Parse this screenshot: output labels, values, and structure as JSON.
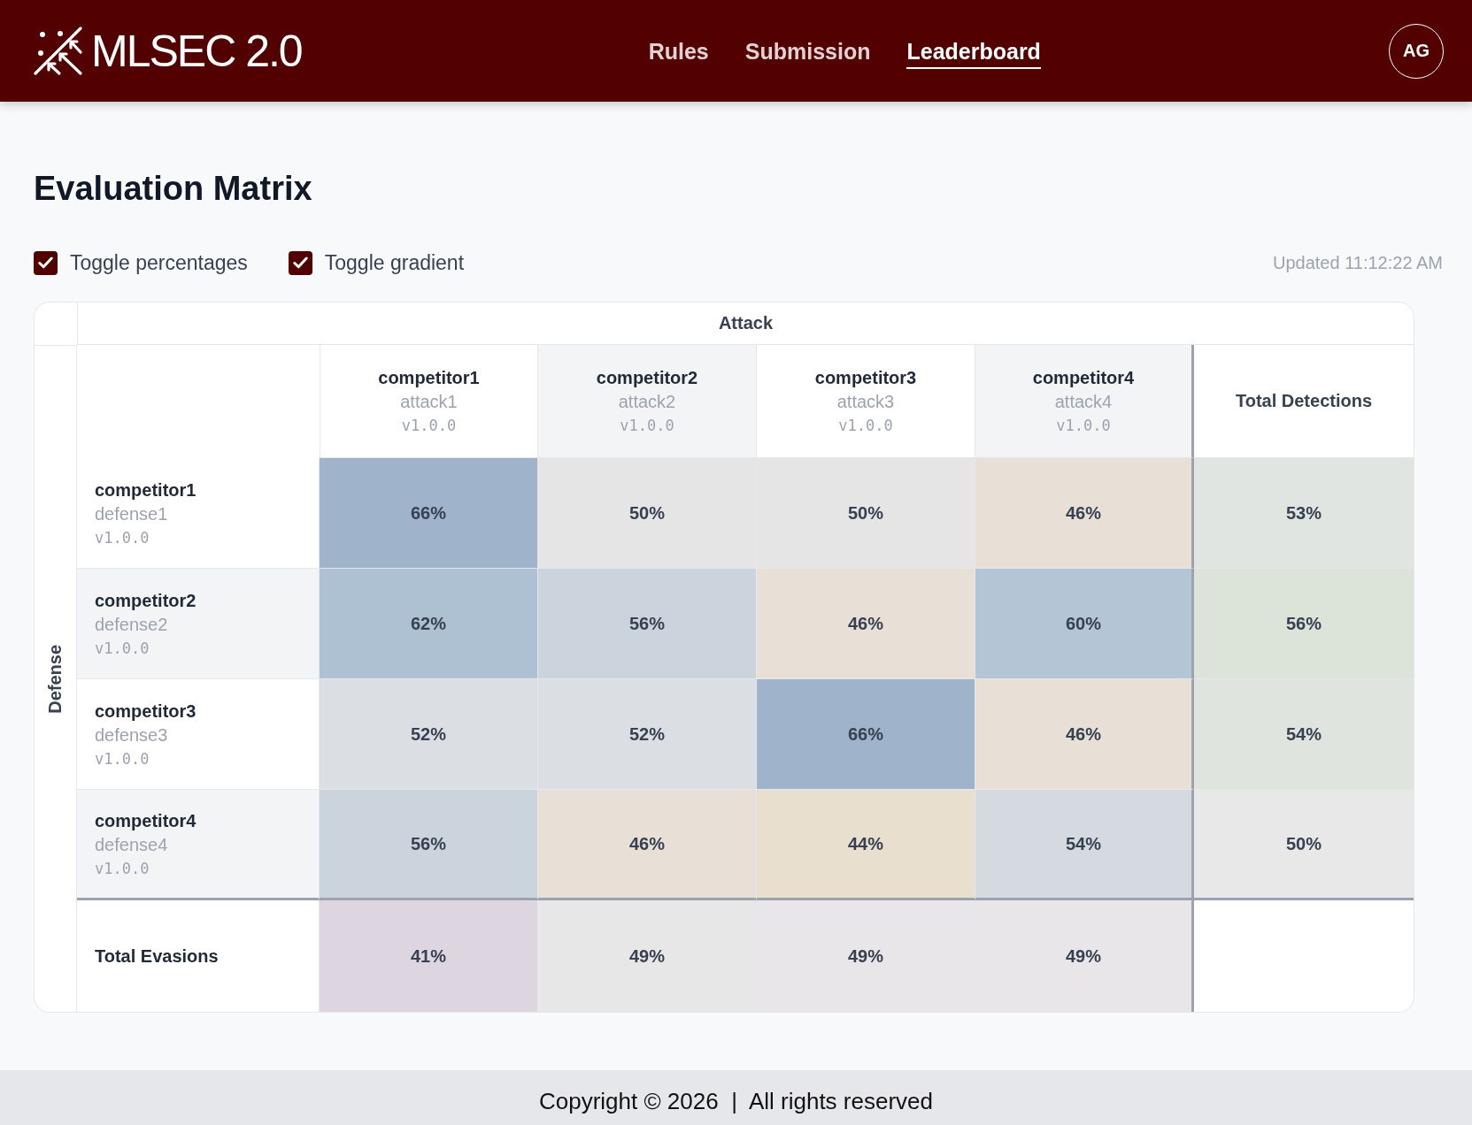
{
  "header": {
    "logo": "MLSEC 2.0",
    "nav": [
      {
        "label": "Rules",
        "selected": false
      },
      {
        "label": "Submission",
        "selected": false
      },
      {
        "label": "Leaderboard",
        "selected": true
      }
    ],
    "avatar": "AG"
  },
  "page": {
    "title": "Evaluation Matrix",
    "toggles": [
      {
        "label": "Toggle percentages",
        "checked": true
      },
      {
        "label": "Toggle gradient",
        "checked": true
      }
    ],
    "updated": "Updated 11:12:22 AM"
  },
  "matrix": {
    "attack_label": "Attack",
    "defense_label": "Defense",
    "columns": [
      {
        "name": "competitor1",
        "submission": "attack1",
        "version": "v1.0.0"
      },
      {
        "name": "competitor2",
        "submission": "attack2",
        "version": "v1.0.0"
      },
      {
        "name": "competitor3",
        "submission": "attack3",
        "version": "v1.0.0"
      },
      {
        "name": "competitor4",
        "submission": "attack4",
        "version": "v1.0.0"
      }
    ],
    "total_column": "Total Detections",
    "rows": [
      {
        "name": "competitor1",
        "submission": "defense1",
        "version": "v1.0.0",
        "cells": [
          {
            "value": "66%",
            "color": "#9fb4cb"
          },
          {
            "value": "50%",
            "color": "#e5e5e5"
          },
          {
            "value": "50%",
            "color": "#e5e5e5"
          },
          {
            "value": "46%",
            "color": "#e8e0d7"
          }
        ],
        "total": {
          "value": "53%",
          "color": "#e1e5e1"
        }
      },
      {
        "name": "competitor2",
        "submission": "defense2",
        "version": "v1.0.0",
        "cells": [
          {
            "value": "62%",
            "color": "#aec1d3"
          },
          {
            "value": "56%",
            "color": "#cbd3dd"
          },
          {
            "value": "46%",
            "color": "#e8e0d7"
          },
          {
            "value": "60%",
            "color": "#b4c5d6"
          }
        ],
        "total": {
          "value": "56%",
          "color": "#dce4da"
        }
      },
      {
        "name": "competitor3",
        "submission": "defense3",
        "version": "v1.0.0",
        "cells": [
          {
            "value": "52%",
            "color": "#dbdfe3"
          },
          {
            "value": "52%",
            "color": "#dbdfe3"
          },
          {
            "value": "66%",
            "color": "#9fb4cb"
          },
          {
            "value": "46%",
            "color": "#e8e0d7"
          }
        ],
        "total": {
          "value": "54%",
          "color": "#dfe4de"
        }
      },
      {
        "name": "competitor4",
        "submission": "defense4",
        "version": "v1.0.0",
        "cells": [
          {
            "value": "56%",
            "color": "#cbd3dd"
          },
          {
            "value": "46%",
            "color": "#e8e0d6"
          },
          {
            "value": "44%",
            "color": "#e9dfcf"
          },
          {
            "value": "54%",
            "color": "#d5dae1"
          }
        ],
        "total": {
          "value": "50%",
          "color": "#e8e8e8"
        }
      }
    ],
    "total_row": {
      "label": "Total Evasions",
      "cells": [
        {
          "value": "41%",
          "color": "#ddd5e0"
        },
        {
          "value": "49%",
          "color": "#e8e7e8"
        },
        {
          "value": "49%",
          "color": "#e8e6e9"
        },
        {
          "value": "49%",
          "color": "#e8e6e9"
        }
      ]
    }
  },
  "footer": "Copyright © 2026  |  All rights reserved"
}
